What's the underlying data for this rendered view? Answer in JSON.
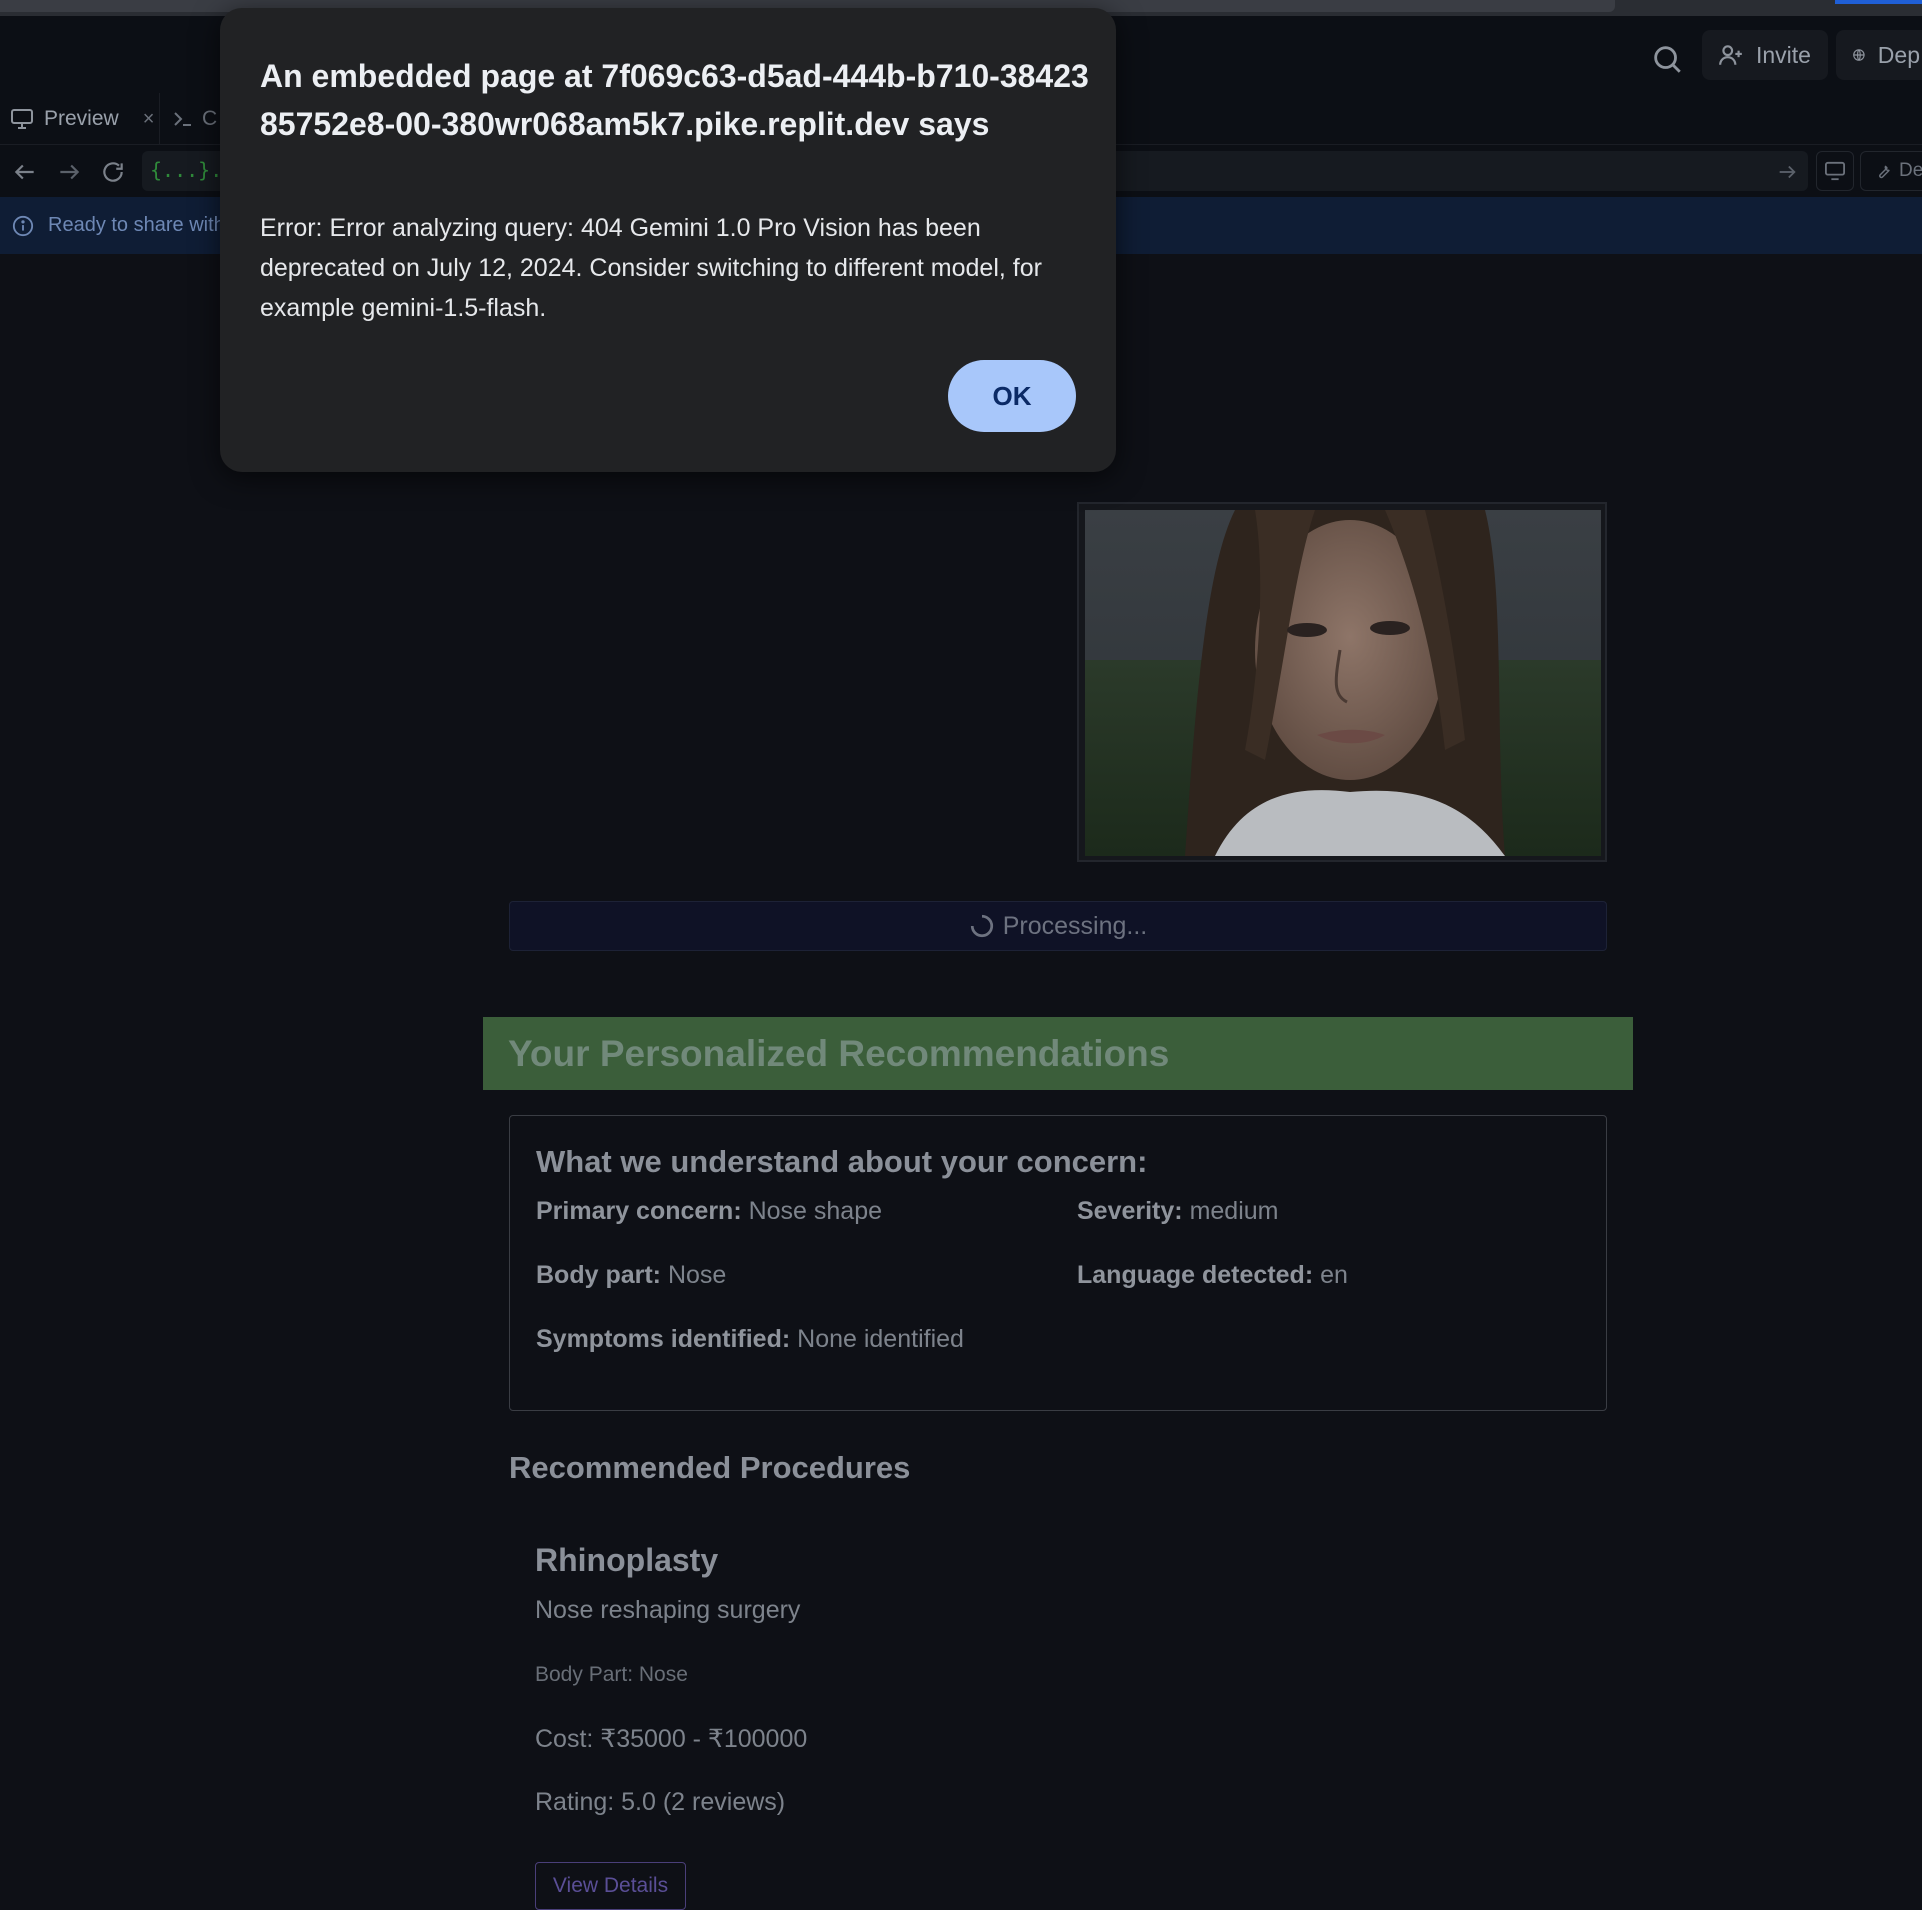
{
  "header": {
    "invite_label": "Invite",
    "deploy_label": "Dep"
  },
  "tabs": {
    "preview_label": "Preview",
    "close_glyph": "×",
    "console_label": "C"
  },
  "urlbar": {
    "url_text": "{...}.rep",
    "devtools_label": "De"
  },
  "banner": {
    "text": "Ready to share with"
  },
  "main": {
    "processing_label": "Processing...",
    "recommendations_title": "Your Personalized Recommendations",
    "concern": {
      "title": "What we understand about your concern:",
      "primary_label": "Primary concern:",
      "primary_value": "Nose shape",
      "severity_label": "Severity:",
      "severity_value": "medium",
      "body_part_label": "Body part:",
      "body_part_value": "Nose",
      "language_label": "Language detected:",
      "language_value": "en",
      "symptoms_label": "Symptoms identified:",
      "symptoms_value": "None identified"
    },
    "procedures_title": "Recommended Procedures",
    "procedure": {
      "name": "Rhinoplasty",
      "description": "Nose reshaping surgery",
      "body_part": "Body Part: Nose",
      "cost": "Cost: ₹35000 - ₹100000",
      "rating": "Rating: 5.0 (2 reviews)",
      "details_button": "View Details"
    }
  },
  "alert": {
    "title": "An embedded page at 7f069c63-d5ad-444b-b710-3842385752e8-00-380wr068am5k7.pike.replit.dev says",
    "message": "Error: Error analyzing query: 404 Gemini 1.0 Pro Vision has been deprecated on July 12, 2024. Consider switching to different model, for example gemini-1.5-flash.",
    "ok_label": "OK"
  },
  "colors": {
    "background": "#0e1016",
    "banner": "#0f1d35",
    "recommendations_header": "#3b5e3a",
    "alert_background": "#212224",
    "ok_button": "#a8c7fa",
    "url_text": "#2f8a3a"
  },
  "icons": [
    "search-icon",
    "add-user-icon",
    "globe-icon",
    "monitor-icon",
    "terminal-icon",
    "back-arrow-icon",
    "forward-arrow-icon",
    "reload-icon",
    "info-icon",
    "spinner-icon",
    "wrench-icon"
  ]
}
